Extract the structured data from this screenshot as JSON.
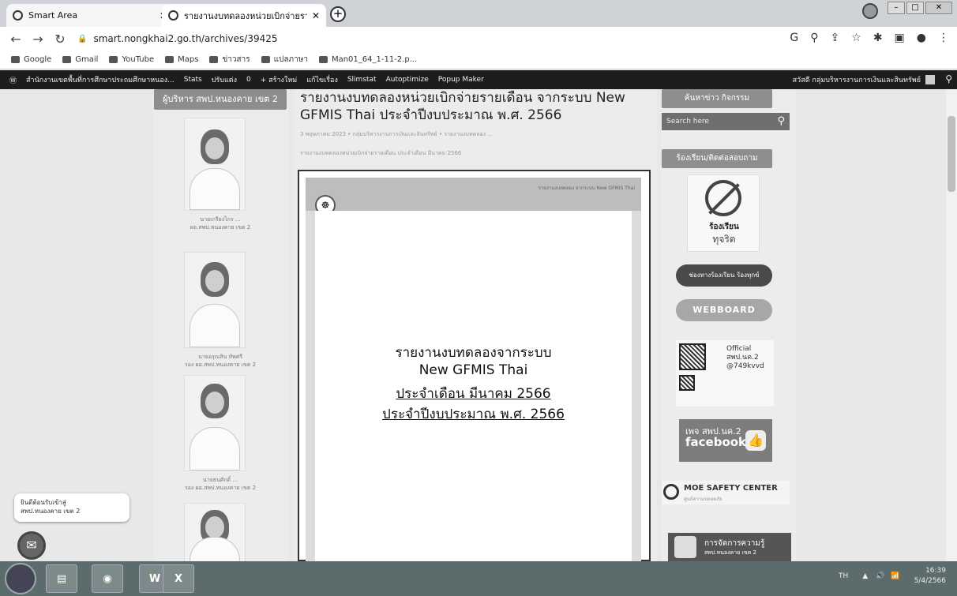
{
  "browser": {
    "tabs": [
      {
        "title": "Smart Area",
        "active": false
      },
      {
        "title": "รายงานงบทดลองหน่วยเบิกจ่ายรา",
        "active": true
      }
    ],
    "new_tab": "+",
    "url": "smart.nongkhai2.go.th/archives/39425",
    "bookmarks": [
      "Google",
      "Gmail",
      "YouTube",
      "Maps",
      "ข่าวสาร",
      "แปลภาษา",
      "Man01_64_1-11-2.p..."
    ]
  },
  "admin_bar": {
    "items": [
      "สำนักงานเขตพื้นที่การศึกษาประถมศึกษาหนอง...",
      "Stats",
      "ปรับแต่ง",
      "0",
      "+ สร้างใหม่",
      "แก้ไขเรื่อง",
      "Slimstat",
      "Autoptimize",
      "Popup Maker"
    ],
    "right_text": "สวัสดี กลุ่มบริหารงานการเงินและสินทรัพย์"
  },
  "left_sidebar": {
    "heading": "ผู้บริหาร สพป.หนองคาย เขต 2",
    "people": [
      {
        "caption1": "นายเกรียงไกร ...",
        "caption2": "ผอ.สพป.หนองคาย เขต 2"
      },
      {
        "caption1": "นายอรุณสิน ทัพศรี",
        "caption2": "รอง ผอ.สพป.หนองคาย เขต 2"
      },
      {
        "caption1": "นายธนศักดิ์ ...",
        "caption2": "รอง ผอ.สพป.หนองคาย เขต 2"
      }
    ]
  },
  "post": {
    "title": "รายงานงบทดลองหน่วยเบิกจ่ายรายเดือน จากระบบ New GFMIS Thai ประจำปีงบประมาณ พ.ศ. 2566",
    "meta": "3 พฤษภาคม 2023  •  กลุ่มบริหารงานการเงินและสินทรัพย์  •  รายงานงบทดลอง ...",
    "excerpt": "รายงานงบทดลองหน่วยเบิกจ่ายรายเดือน ประจำเดือน มีนาคม 2566",
    "doc_header_text": "รายงานงบทดลอง จากระบบ New GFMIS Thai",
    "doc_lines": [
      "รายงานงบทดลองจากระบบ",
      "New GFMIS Thai",
      "ประจำเดือน มีนาคม 2566",
      "ประจำปีงบประมาณ พ.ศ. 2566"
    ]
  },
  "right_sidebar": {
    "heading_news": "ค้นหาข่าว กิจกรรม",
    "search_placeholder": "Search here",
    "heading_complaint": "ร้องเรียน/ติดต่อสอบถาม",
    "nobribe_line1": "ร้องเรียน",
    "nobribe_line2": "ทุจริต",
    "complaint_button": "ช่องทางร้องเรียน ร้องทุกข์",
    "webboard_button": "WEBBOARD",
    "qr_text": [
      "Official",
      "สพป.นค.2",
      "@749kvvd"
    ],
    "fb_line1": "เพจ สพป.นค.2",
    "fb_line2": "facebook",
    "moe_title": "MOE SAFETY CENTER",
    "moe_sub": "ศูนย์ความปลอดภัย",
    "km_title": "การจัดการความรู้",
    "km_sub": "สพป.หนองคาย เขต 2"
  },
  "chat": {
    "line1": "ยินดีต้อนรับเข้าสู่",
    "line2": "สพป.หนองคาย เขต 2"
  },
  "taskbar": {
    "apps": [
      "W",
      "X"
    ],
    "lang": "TH",
    "time": "16:39",
    "date": "5/4/2566"
  }
}
